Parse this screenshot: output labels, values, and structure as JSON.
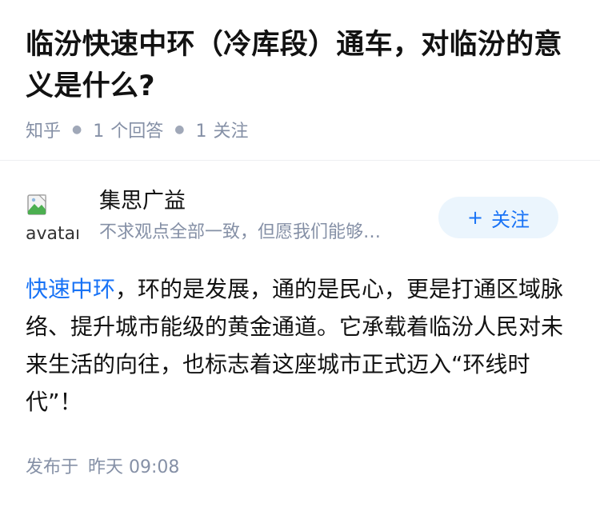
{
  "question": {
    "title": "临汾快速中环（冷库段）通车，对临汾的意义是什么?",
    "source": "知乎",
    "answer_count": "1",
    "answer_label": "个回答",
    "follower_count": "1",
    "follower_label": "关注"
  },
  "author": {
    "name": "集思广益",
    "bio": "不求观点全部一致，但愿我们能够…",
    "avatar_alt": "avatar",
    "follow_label": "关注",
    "follow_icon": "plus-icon"
  },
  "answer": {
    "link_text": "快速中环",
    "body": "，环的是发展，通的是民心，更是打通区域脉络、提升城市能级的黄金通道。它承载着临汾人民对未来生活的向往，也标志着这座城市正式迈入“环线时代”！"
  },
  "publish": {
    "label": "发布于",
    "time": "昨天 09:08"
  },
  "colors": {
    "accent": "#1772f6",
    "follow_bg": "#ebf5fd",
    "meta_text": "#8590a6",
    "title_text": "#121212"
  }
}
